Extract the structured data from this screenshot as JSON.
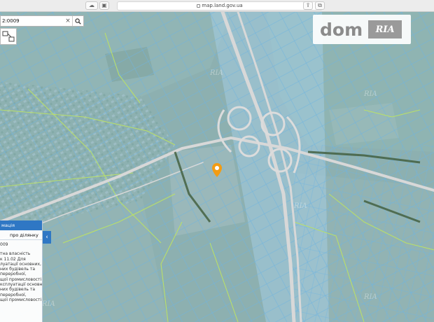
{
  "browser": {
    "url": "map.land.gov.ua"
  },
  "search": {
    "value": "2:0009"
  },
  "brand": {
    "word": "dom",
    "badge": "RIA"
  },
  "panel": {
    "header": "мація",
    "tab": "про ділянку",
    "lines": [
      "009",
      "",
      "тна власність",
      "к 11.02 Для",
      "луатації основних,",
      "них будівель та",
      "переробної,",
      "щої промисловості",
      "ксплуатації основних,",
      "них будівель та",
      "переробної,",
      "щої промисловості"
    ]
  },
  "colors": {
    "parcel_fill": "#8fc3e3",
    "parcel_stroke": "#5fa6d6",
    "boundary_green": "#b9df6a",
    "road": "#d9d9d9",
    "panel_accent": "#2f77c4",
    "marker": "#f39c12"
  },
  "icons": [
    "cloud-icon",
    "tabs-icon",
    "lock-icon",
    "reload-icon",
    "share-icon",
    "window-icon",
    "close-icon",
    "search-icon",
    "map-tools-icon",
    "chevron-left-icon",
    "location-pin-icon"
  ]
}
